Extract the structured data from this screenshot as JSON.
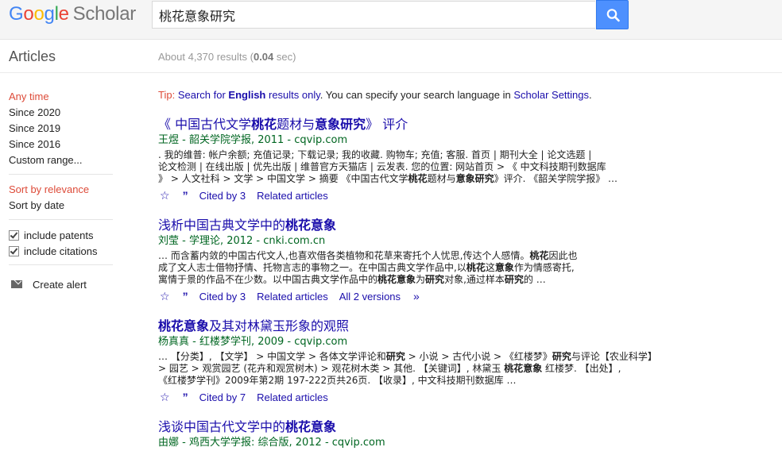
{
  "logo": {
    "google": [
      "G",
      "o",
      "o",
      "g",
      "l",
      "e"
    ],
    "scholar": "Scholar"
  },
  "search": {
    "query": "桃花意象研究"
  },
  "header": {
    "section": "Articles",
    "stats_prefix": "About 4,370 results (",
    "stats_time": "0.04",
    "stats_suffix": " sec)"
  },
  "sidebar": {
    "time": [
      "Any time",
      "Since 2020",
      "Since 2019",
      "Since 2016",
      "Custom range..."
    ],
    "sort": [
      "Sort by relevance",
      "Sort by date"
    ],
    "checks": [
      "include patents",
      "include citations"
    ],
    "alert": "Create alert"
  },
  "tip": {
    "label": "Tip:",
    "part1": "Search for ",
    "english": "English",
    "part2": " results only",
    "part3": ". You can specify your search language in ",
    "settings": "Scholar Settings",
    "part4": "."
  },
  "results": [
    {
      "title": "《 中国古代文学<b>桃花</b>题材与<b>意象研究</b>》 评介",
      "meta": "王煜 - 韶关学院学报, 2011 - cqvip.com",
      "snippet": ". 我的维普: 帐户余额; 充值记录; 下载记录; 我的收藏. 购物车; 充值; 客服. 首页 | 期刊大全 | 论文选题 |\n论文检测 | 在线出版 | 优先出版 | 维普官方天猫店 | 云发表. 您的位置: 网站首页 > 《 中文科技期刊数据库\n》 > 人文社科 > 文学 > 中国文学 > 摘要 《中国古代文学<b>桃花</b>题材与<b>意象研究</b>》评介. 《韶关学院学报》 …",
      "links": [
        "Cited by 3",
        "Related articles"
      ]
    },
    {
      "title": "浅析中国古典文学中的<b>桃花意象</b>",
      "meta": "刘莹 - 学理论, 2012 - cnki.com.cn",
      "snippet": "… 而含蓄内敛的中国古代文人,也喜欢借各类植物和花草来寄托个人忧思,传达个人感情。<b>桃花</b>因此也\n成了文人志士借物抒情、托物言志的事物之一。在中国古典文学作品中,以<b>桃花</b>这<b>意象</b>作为情感寄托,\n寓情于景的作品不在少数。以中国古典文学作品中的<b>桃花意象</b>为<b>研究</b>对象,通过样本<b>研究</b>的 …",
      "links": [
        "Cited by 3",
        "Related articles",
        "All 2 versions"
      ]
    },
    {
      "title": "<b>桃花意象</b>及其对林黛玉形象的观照",
      "meta": "杨真真 - 红楼梦学刊, 2009 - cqvip.com",
      "snippet": "… 【分类】, 【文学】 > 中国文学 > 各体文学评论和<b>研究</b> > 小说 > 古代小说 > 《红楼梦》<b>研究</b>与评论【农业科学】\n> 园艺 > 观赏园艺 (花卉和观赏树木) > 观花树木类 > 其他. 【关键词】, 林黛玉 <b>桃花意象</b> 红楼梦. 【出处】,\n《红楼梦学刊》2009年第2期 197-222页共26页. 【收录】, 中文科技期刊数据库 …",
      "links": [
        "Cited by 7",
        "Related articles"
      ]
    },
    {
      "title": "浅谈中国古代文学中的<b>桃花意象</b>",
      "meta": "由娜 - 鸡西大学学报: 综合版, 2012 - cqvip.com",
      "snippet": "",
      "links": []
    }
  ],
  "colors": {
    "accent_red": "#dd4b39",
    "link": "#1a0dab",
    "green": "#006621",
    "search_btn": "#4d90fe"
  }
}
